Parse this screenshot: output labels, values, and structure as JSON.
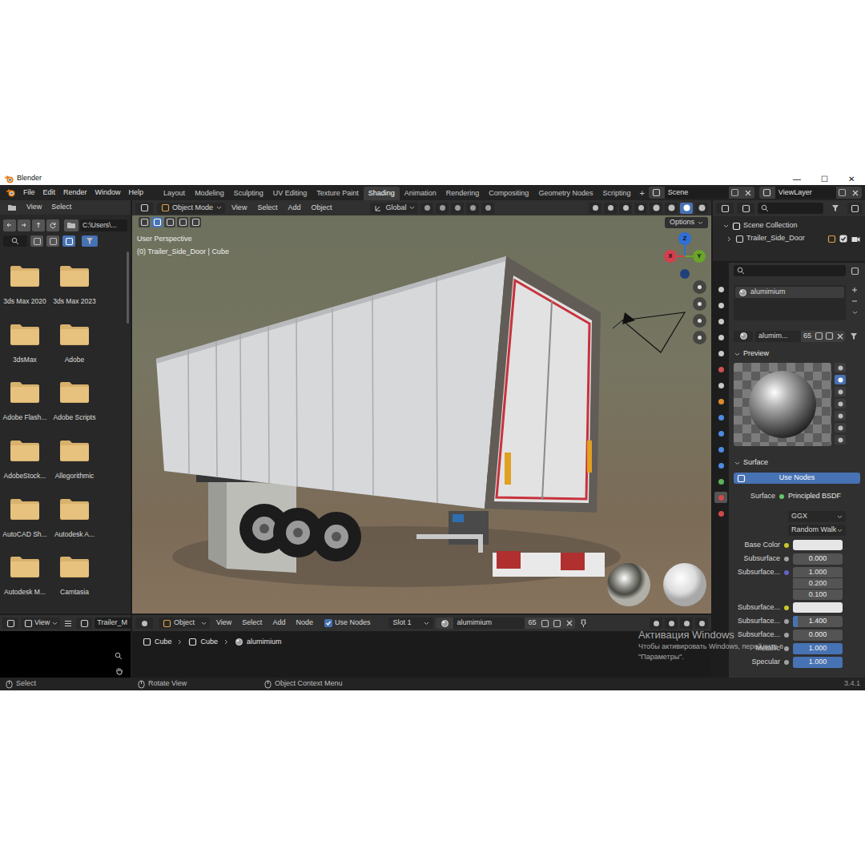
{
  "window": {
    "title": "Blender",
    "controls": [
      "—",
      "☐",
      "✕"
    ]
  },
  "menu": [
    "File",
    "Edit",
    "Render",
    "Window",
    "Help"
  ],
  "workspaces": [
    {
      "label": "Layout",
      "selected": false
    },
    {
      "label": "Modeling",
      "selected": false
    },
    {
      "label": "Sculpting",
      "selected": false
    },
    {
      "label": "UV Editing",
      "selected": false
    },
    {
      "label": "Texture Paint",
      "selected": false
    },
    {
      "label": "Shading",
      "selected": true
    },
    {
      "label": "Animation",
      "selected": false
    },
    {
      "label": "Rendering",
      "selected": false
    },
    {
      "label": "Compositing",
      "selected": false
    },
    {
      "label": "Geometry Nodes",
      "selected": false
    },
    {
      "label": "Scripting",
      "selected": false
    }
  ],
  "workspace_add": "+",
  "scene": "Scene",
  "view_layer": "ViewLayer",
  "file_browser": {
    "menu": [
      "View",
      "Select"
    ],
    "path": "C:\\Users\\...",
    "folders": [
      {
        "label": "3ds Max 2020"
      },
      {
        "label": "3ds Max 2023"
      },
      {
        "label": "3dsMax"
      },
      {
        "label": "Adobe"
      },
      {
        "label": "Adobe Flash..."
      },
      {
        "label": "Adobe Scripts"
      },
      {
        "label": "AdobeStock..."
      },
      {
        "label": "Allegorithmic"
      },
      {
        "label": "AutoCAD Sh..."
      },
      {
        "label": "Autodesk A..."
      },
      {
        "label": "Autodesk M..."
      },
      {
        "label": "Camtasia"
      }
    ]
  },
  "image_editor": {
    "view": "View",
    "image": "Trailer_M"
  },
  "viewport": {
    "mode": "Object Mode",
    "menu": [
      "View",
      "Select",
      "Add",
      "Object"
    ],
    "orientation": "Global",
    "options": "Options",
    "overlay": [
      "User Perspective",
      "(0) Trailer_Side_Door | Cube"
    ],
    "axes": [
      {
        "label": "Z",
        "color": "#2f6fd6"
      },
      {
        "label": "X",
        "color": "#d3404f"
      },
      {
        "label": "Y",
        "color": "#6aa52a"
      }
    ]
  },
  "shader_editor": {
    "type": "Object",
    "menu": [
      "View",
      "Select",
      "Add",
      "Node"
    ],
    "use_nodes": {
      "label": "Use Nodes",
      "checked": true
    },
    "slot": "Slot 1",
    "material": "alumimium",
    "users": "65",
    "breadcrumbs": [
      "Cube",
      "Cube",
      "alumimium"
    ]
  },
  "outliner": {
    "items": [
      {
        "label": "Scene Collection",
        "expanded": true
      },
      {
        "label": "Trailer_Side_Door",
        "expanded": false
      }
    ]
  },
  "properties": {
    "slots": [
      {
        "label": "alumimium",
        "selected": true
      }
    ],
    "material": "alumim...",
    "users": "65",
    "panels": [
      {
        "label": "Preview",
        "expanded": true
      },
      {
        "label": "Surface",
        "expanded": true
      }
    ],
    "use_nodes": "Use Nodes",
    "surface_label": "Surface",
    "surface_value": "Principled BSDF",
    "distribution": "GGX",
    "subsurface_method": "Random Walk",
    "inputs": [
      {
        "label": "Base Color",
        "kind": "color",
        "color": "#e6e6e6"
      },
      {
        "label": "Subsurface",
        "kind": "number",
        "value": "0.000",
        "level": 0
      },
      {
        "label": "Subsurface...",
        "kind": "vector",
        "values": [
          "1.000",
          "0.200",
          "0.100"
        ]
      },
      {
        "label": "Subsurface...",
        "kind": "color",
        "color": "#e6e6e6"
      },
      {
        "label": "Subsurface...",
        "kind": "number",
        "value": "1.400",
        "level": 0.1
      },
      {
        "label": "Subsurface...",
        "kind": "number",
        "value": "0.000",
        "level": 0
      },
      {
        "label": "Metallic",
        "kind": "number",
        "value": "1.000",
        "level": 1
      },
      {
        "label": "Specular",
        "kind": "number",
        "value": "1.000",
        "level": 1
      }
    ]
  },
  "status_bar": {
    "items": [
      "Select",
      "Rotate View",
      "Object Context Menu"
    ],
    "version": "3.4.1"
  },
  "watermark": {
    "title": "Активация Windows",
    "lines": [
      "Чтобы активировать Windows, перейдите в",
      "\"Параметры\"."
    ]
  }
}
